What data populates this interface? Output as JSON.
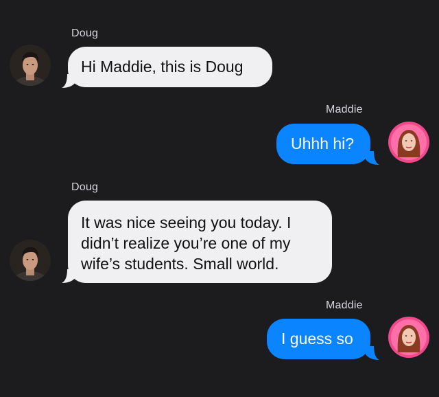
{
  "conversation": {
    "messages": [
      {
        "sender": "Doug",
        "direction": "incoming",
        "text": "Hi Maddie, this is Doug"
      },
      {
        "sender": "Maddie",
        "direction": "outgoing",
        "text": "Uhhh hi?"
      },
      {
        "sender": "Doug",
        "direction": "incoming",
        "lines": [
          "It was nice seeing you today. I",
          "didn’t realize you’re one of my",
          "wife’s students. Small world."
        ]
      },
      {
        "sender": "Maddie",
        "direction": "outgoing",
        "text": "I guess so"
      }
    ]
  },
  "colors": {
    "background": "#1c1c1e",
    "incoming_bubble": "#f0f0f2",
    "outgoing_bubble": "#0a84ff"
  }
}
